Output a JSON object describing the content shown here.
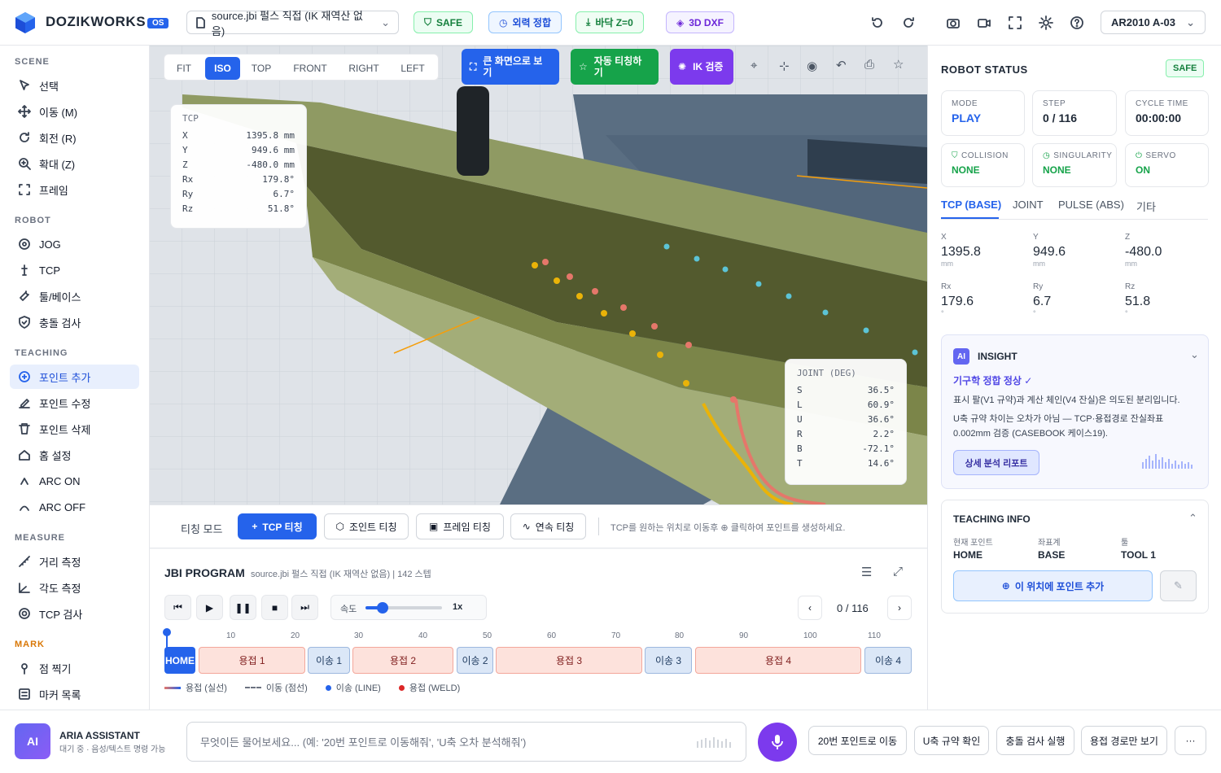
{
  "header": {
    "brand": "DOZIKWORKS",
    "brand_badge": "OS",
    "file_selector": "source.jbi 펄스 직접 (IK 재역산 없음)",
    "chips": {
      "safe": "SAFE",
      "posture": "외력 정합",
      "floor": "바닥 Z=0",
      "dxf": "3D DXF"
    },
    "robot_selector": "AR2010 A-03"
  },
  "sidebar": {
    "scene_title": "SCENE",
    "scene": [
      "선택",
      "이동 (M)",
      "회전 (R)",
      "확대 (Z)",
      "프레임"
    ],
    "robot_title": "ROBOT",
    "robot": [
      "JOG",
      "TCP",
      "툴/베이스",
      "충돌 검사"
    ],
    "teaching_title": "TEACHING",
    "teaching": [
      "포인트 추가",
      "포인트 수정",
      "포인트 삭제",
      "홈 설정",
      "ARC ON",
      "ARC OFF"
    ],
    "measure_title": "MEASURE",
    "measure": [
      "거리 측정",
      "각도 측정",
      "TCP 검사"
    ],
    "mark_title": "MARK",
    "mark": [
      "점 찍기",
      "마커 목록"
    ]
  },
  "viewport": {
    "view_tabs": [
      "FIT",
      "ISO",
      "TOP",
      "FRONT",
      "RIGHT",
      "LEFT"
    ],
    "active_view": "ISO",
    "actions": {
      "fullscreen": "큰 화면으로 보기",
      "auto_teach": "자동 티칭하기",
      "ik_verify": "IK 검증"
    },
    "tcp": {
      "title": "TCP",
      "rows": [
        [
          "X",
          "1395.8 mm"
        ],
        [
          "Y",
          "949.6 mm"
        ],
        [
          "Z",
          "-480.0 mm"
        ],
        [
          "Rx",
          "179.8°"
        ],
        [
          "Ry",
          "6.7°"
        ],
        [
          "Rz",
          "51.8°"
        ]
      ]
    },
    "joint": {
      "title": "JOINT (DEG)",
      "rows": [
        [
          "S",
          "36.5°"
        ],
        [
          "L",
          "60.9°"
        ],
        [
          "U",
          "36.6°"
        ],
        [
          "R",
          "2.2°"
        ],
        [
          "B",
          "-72.1°"
        ],
        [
          "T",
          "14.6°"
        ]
      ]
    }
  },
  "teach_bar": {
    "mode_label": "티칭 모드",
    "tcp": "TCP 티칭",
    "joint": "조인트 티칭",
    "frame": "프레임 티칭",
    "continuous": "연속 티칭",
    "hint": "TCP를 원하는 위치로 이동후 ⊕ 클릭하여 포인트를 생성하세요."
  },
  "program": {
    "title": "JBI PROGRAM",
    "subtitle": "source.jbi 펄스 직접 (IK 재역산 없음) | 142 스텝",
    "speed_label": "속도",
    "speed_value": "1x",
    "speed_level": 0.22,
    "step_display": "0 / 116",
    "ticks": [
      "10",
      "20",
      "30",
      "40",
      "50",
      "60",
      "70",
      "80",
      "90",
      "100",
      "110"
    ],
    "segments": [
      "HOME",
      "용접 1",
      "이송 1",
      "용접 2",
      "이송 2",
      "용접 3",
      "이송 3",
      "용접 4",
      "이송 4"
    ],
    "legend": [
      "용접 (실선)",
      "이동 (점선)",
      "이송 (LINE)",
      "용접 (WELD)"
    ]
  },
  "status": {
    "title": "ROBOT STATUS",
    "safe": "SAFE",
    "cards": [
      {
        "label": "MODE",
        "value": "PLAY"
      },
      {
        "label": "STEP",
        "value": "0 / 116"
      },
      {
        "label": "CYCLE TIME",
        "value": "00:00:00"
      },
      {
        "label": "COLLISION",
        "value": "NONE"
      },
      {
        "label": "SINGULARITY",
        "value": "NONE"
      },
      {
        "label": "SERVO",
        "value": "ON"
      }
    ],
    "tabs": [
      "TCP (BASE)",
      "JOINT",
      "PULSE (ABS)",
      "기타"
    ],
    "coords": [
      {
        "label": "X",
        "value": "1395.8",
        "unit": "mm"
      },
      {
        "label": "Y",
        "value": "949.6",
        "unit": "mm"
      },
      {
        "label": "Z",
        "value": "-480.0",
        "unit": "mm"
      },
      {
        "label": "Rx",
        "value": "179.6",
        "unit": "°"
      },
      {
        "label": "Ry",
        "value": "6.7",
        "unit": "°"
      },
      {
        "label": "Rz",
        "value": "51.8",
        "unit": "°"
      }
    ]
  },
  "insight": {
    "badge": "AI",
    "title": "INSIGHT",
    "headline": "기구학 정합 정상 ✓",
    "line1": "표시 팔(V1 규약)과 계산 체인(V4 잔실)은 의도된 분리입니다.",
    "line2": "U축 규약 차이는 오차가 아님 — TCP·용접경로 잔실좌표 0.002mm 검증 (CASEBOOK 케이스19).",
    "button": "상세 분석 리포트"
  },
  "teaching_info": {
    "title": "TEACHING INFO",
    "labels": [
      "현재 포인트",
      "좌표계",
      "툴"
    ],
    "values": [
      "HOME",
      "BASE",
      "TOOL 1"
    ],
    "add_button": "이 위치에 포인트 추가"
  },
  "assistant": {
    "badge": "AI",
    "name": "ARIA ASSISTANT",
    "status": "대기 중 · 음성/텍스트 명령 가능",
    "placeholder": "무엇이든 물어보세요... (예: '20번 포인트로 이동해줘', 'U축 오차 분석해줘')",
    "quick": [
      "20번 포인트로 이동",
      "U축 규약 확인",
      "충돌 검사 실행",
      "용접 경로만 보기"
    ],
    "more": "···"
  },
  "colors": {
    "accent": "#2563eb",
    "green": "#16a34a",
    "purple": "#7c3aed",
    "weld": "#e5776a",
    "travel": "#f0b429"
  }
}
